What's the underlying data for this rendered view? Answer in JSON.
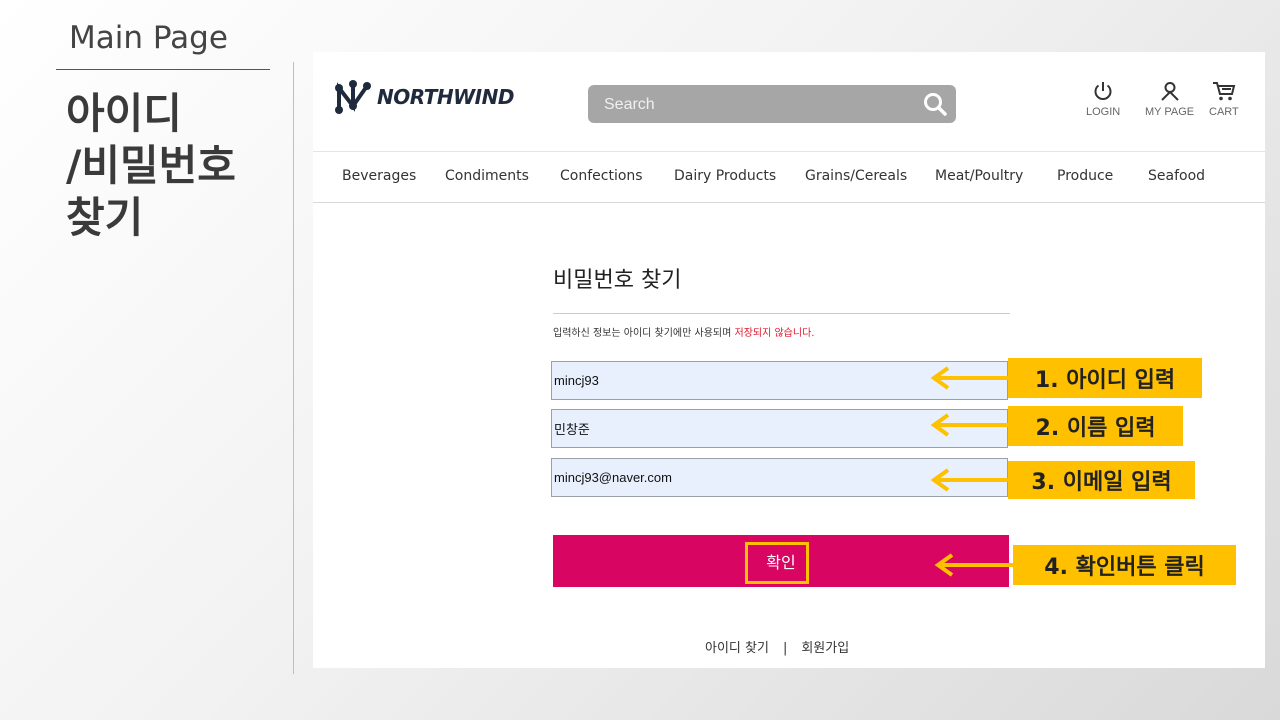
{
  "slide": {
    "label": "Main Page",
    "title": "아이디\n/비밀번호\n찾기"
  },
  "header": {
    "logo_text": "NORTHWIND",
    "search_placeholder": "Search",
    "utilities": [
      {
        "label": "LOGIN",
        "icon": "power-icon"
      },
      {
        "label": "MY PAGE",
        "icon": "user-icon"
      },
      {
        "label": "CART",
        "icon": "cart-icon"
      }
    ]
  },
  "nav": {
    "items": [
      "Beverages",
      "Condiments",
      "Confections",
      "Dairy Products",
      "Grains/Cereals",
      "Meat/Poultry",
      "Produce",
      "Seafood"
    ]
  },
  "form": {
    "title": "비밀번호 찾기",
    "notice_prefix": "입력하신 정보는 아이디 찾기에만 사용되며 ",
    "notice_highlight": "저장되지 않습니다.",
    "id_value": "mincj93",
    "name_value": "민창준",
    "email_value": "mincj93@naver.com",
    "confirm_label": "확인"
  },
  "footer": {
    "find_id": "아이디 찾기",
    "separator": "|",
    "signup": "회원가입"
  },
  "annotations": {
    "step1": "1. 아이디 입력",
    "step2": "2. 이름 입력",
    "step3": "3. 이메일 입력",
    "step4": "4. 확인버튼 클릭"
  },
  "colors": {
    "accent": "#d80563",
    "callout": "#ffc000",
    "field_bg": "#e8f0fe",
    "notice_red": "#e0142b"
  }
}
